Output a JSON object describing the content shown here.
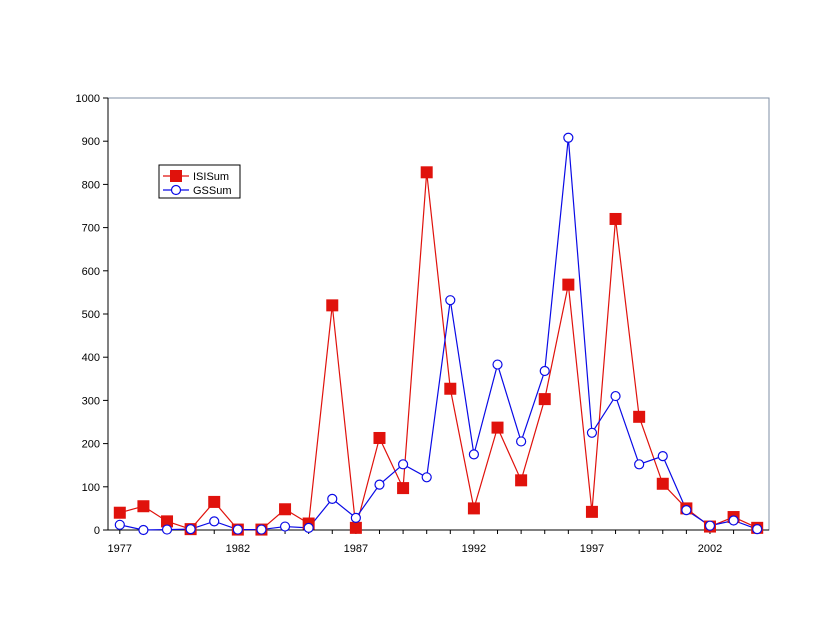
{
  "chart_data": {
    "type": "line",
    "title": "",
    "xlabel": "",
    "ylabel": "",
    "x": [
      1977,
      1978,
      1979,
      1980,
      1981,
      1982,
      1983,
      1984,
      1985,
      1986,
      1987,
      1988,
      1989,
      1990,
      1991,
      1992,
      1993,
      1994,
      1995,
      1996,
      1997,
      1998,
      1999,
      2000,
      2001,
      2002,
      2003,
      2004
    ],
    "xlim": [
      1976.5,
      2004.5
    ],
    "ylim": [
      0,
      1000
    ],
    "yticks": [
      0,
      100,
      200,
      300,
      400,
      500,
      600,
      700,
      800,
      900,
      1000
    ],
    "xticks": [
      1977,
      1982,
      1987,
      1992,
      1997,
      2002
    ],
    "grid": false,
    "legend_position": "upper-left",
    "series": [
      {
        "name": "ISISum",
        "color": "#e0120c",
        "marker": "filled-square",
        "values": [
          40,
          55,
          20,
          2,
          65,
          1,
          1,
          48,
          15,
          520,
          5,
          213,
          97,
          828,
          327,
          50,
          237,
          115,
          303,
          568,
          42,
          720,
          262,
          107,
          50,
          8,
          30,
          5
        ]
      },
      {
        "name": "GSSum",
        "color": "#0a0ae6",
        "marker": "open-circle",
        "values": [
          12,
          0,
          1,
          2,
          20,
          1,
          1,
          8,
          5,
          72,
          28,
          105,
          152,
          122,
          532,
          175,
          383,
          205,
          368,
          908,
          225,
          310,
          152,
          171,
          46,
          10,
          22,
          2
        ]
      }
    ]
  }
}
